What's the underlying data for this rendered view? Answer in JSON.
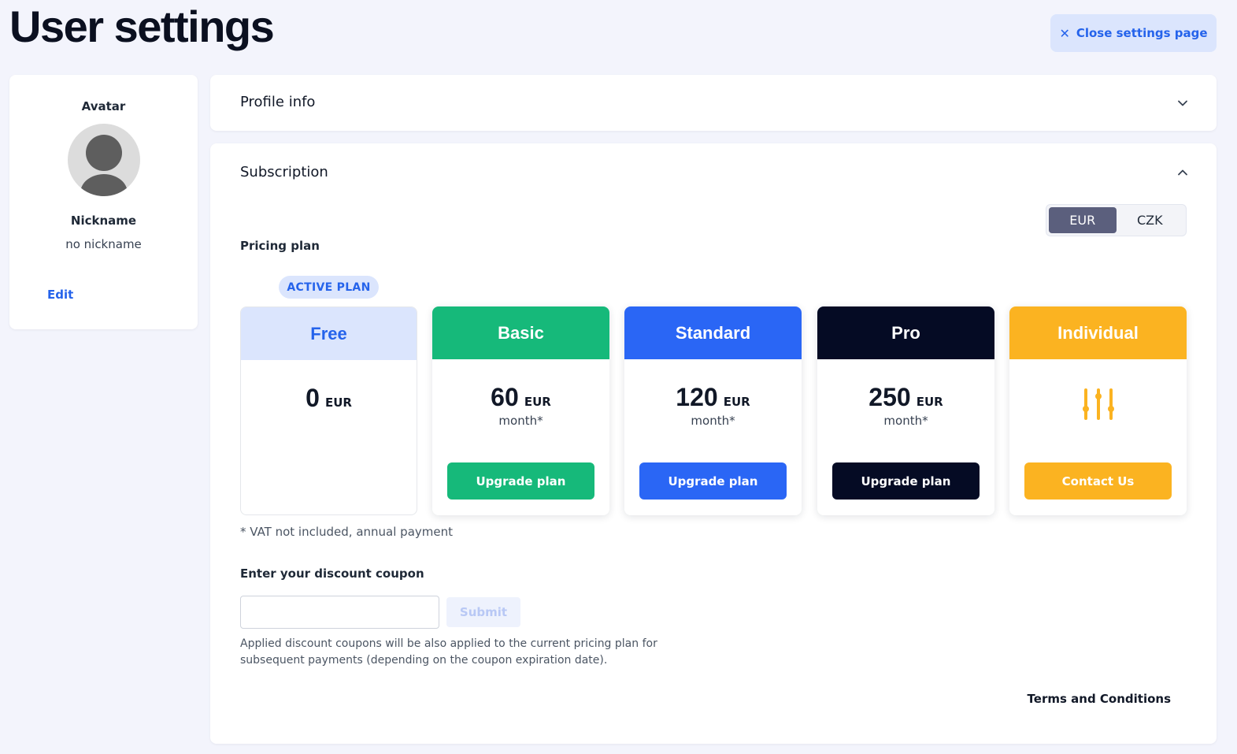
{
  "page": {
    "title": "User settings",
    "close_label": "Close settings page"
  },
  "profile": {
    "avatar_label": "Avatar",
    "nickname_label": "Nickname",
    "nickname_value": "no nickname",
    "edit_label": "Edit"
  },
  "sections": {
    "profile_info": "Profile info",
    "subscription": "Subscription"
  },
  "subscription": {
    "currency_options": [
      "EUR",
      "CZK"
    ],
    "selected_currency": "EUR",
    "pricing_label": "Pricing plan",
    "active_badge": "ACTIVE PLAN",
    "active_plan": "Free",
    "plans": [
      {
        "name": "Free",
        "price": "0",
        "currency": "EUR",
        "period": "",
        "button": "",
        "color": "#dbe5fd",
        "title_color": "#2563eb"
      },
      {
        "name": "Basic",
        "price": "60",
        "currency": "EUR",
        "period": "month*",
        "button": "Upgrade plan",
        "color": "#16b97a",
        "title_color": "#ffffff"
      },
      {
        "name": "Standard",
        "price": "120",
        "currency": "EUR",
        "period": "month*",
        "button": "Upgrade plan",
        "color": "#2a66f5",
        "title_color": "#ffffff"
      },
      {
        "name": "Pro",
        "price": "250",
        "currency": "EUR",
        "period": "month*",
        "button": "Upgrade plan",
        "color": "#050b24",
        "title_color": "#ffffff"
      },
      {
        "name": "Individual",
        "price": "",
        "currency": "",
        "period": "",
        "button": "Contact Us",
        "color": "#fbb321",
        "title_color": "#ffffff",
        "icon": "sliders-icon"
      }
    ],
    "vat_note": "* VAT not included, annual payment",
    "coupon_label": "Enter your discount coupon",
    "coupon_value": "",
    "submit_label": "Submit",
    "coupon_help": "Applied discount coupons will be also applied to the current pricing plan for subsequent payments (depending on the coupon expiration date).",
    "terms_label": "Terms and Conditions"
  },
  "colors": {
    "accent": "#2563eb",
    "background": "#f3f4fc",
    "toggle_active": "#5b5f7d"
  }
}
